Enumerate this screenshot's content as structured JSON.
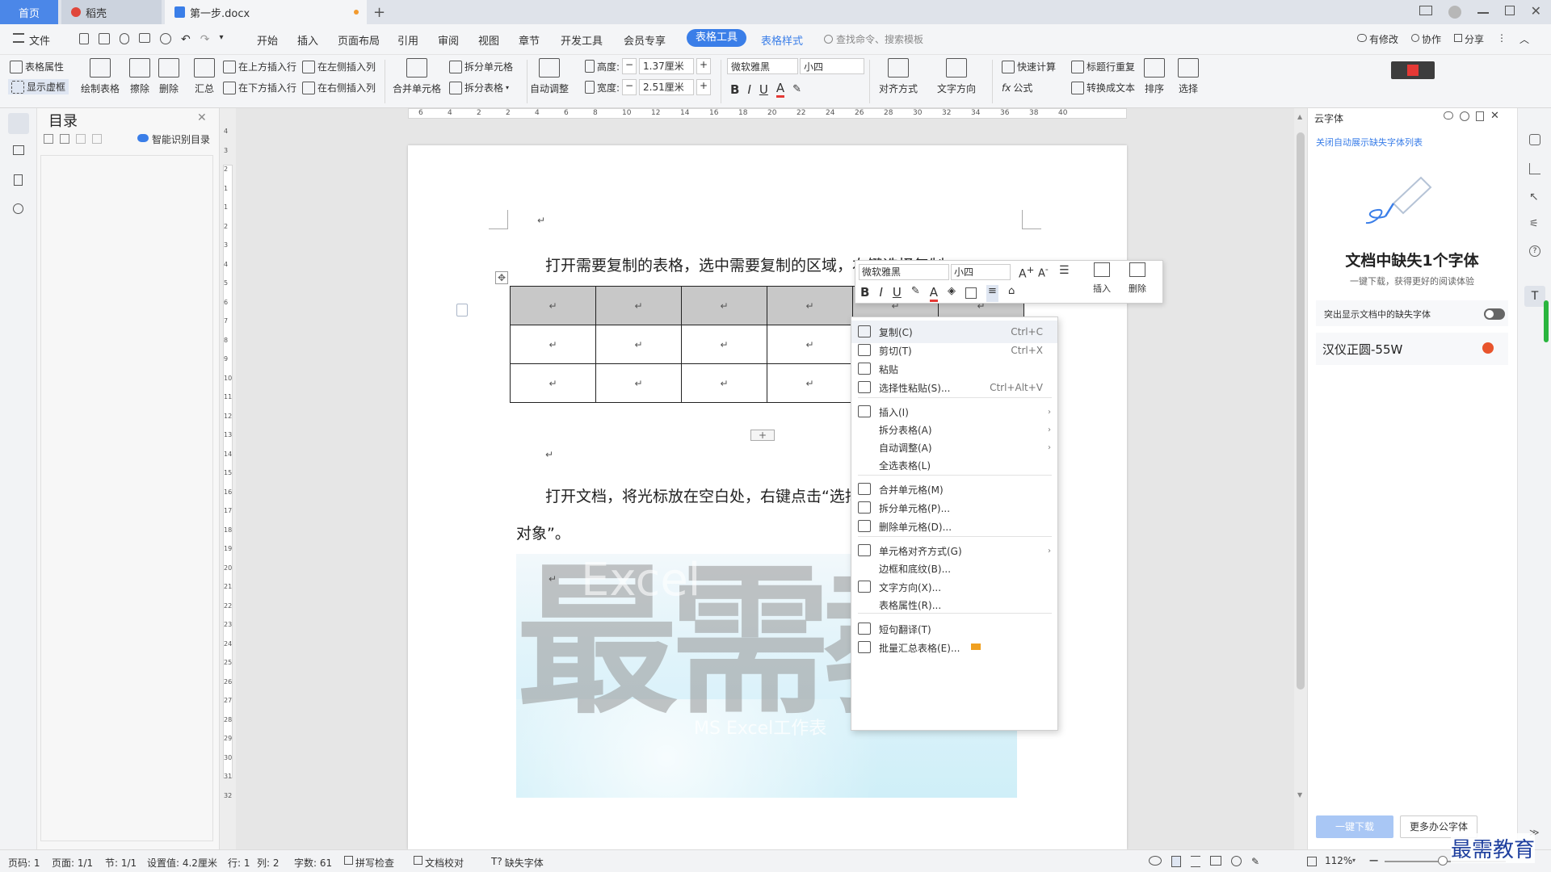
{
  "tabs": {
    "home": "首页",
    "daoke": "稻壳",
    "doc": "第一步.docx",
    "add": "+"
  },
  "menu": {
    "file": "文件",
    "items": [
      "开始",
      "插入",
      "页面布局",
      "引用",
      "审阅",
      "视图",
      "章节",
      "开发工具",
      "会员专享"
    ],
    "active": "表格工具",
    "style": "表格样式",
    "search": "查找命令、搜索模板",
    "right": [
      "有修改",
      "协作",
      "分享"
    ]
  },
  "ribbon": {
    "table_props": "表格属性",
    "show_lines": "显示虚框",
    "draw_table": "绘制表格",
    "erase": "擦除",
    "delete": "删除",
    "sum": "汇总",
    "ins_above": "在上方插入行",
    "ins_below": "在下方插入行",
    "ins_left": "在左侧插入列",
    "ins_right": "在右侧插入列",
    "merge": "合并单元格",
    "split_cell": "拆分单元格",
    "split_table": "拆分表格",
    "auto_fit": "自动调整",
    "height_label": "高度:",
    "height_val": "1.37厘米",
    "width_label": "宽度:",
    "width_val": "2.51厘米",
    "font": "微软雅黑",
    "size": "小四",
    "align": "对齐方式",
    "text_dir": "文字方向",
    "quick_calc": "快速计算",
    "repeat_header": "标题行重复",
    "formula": "公式",
    "to_text": "转换成文本",
    "sort": "排序",
    "select": "选择"
  },
  "toc": {
    "title": "目录",
    "smart": "智能识别目录"
  },
  "ruler": {
    "h": [
      "6",
      "4",
      "2",
      "2",
      "4",
      "6",
      "8",
      "10",
      "12",
      "14",
      "16",
      "18",
      "20",
      "22",
      "24",
      "26",
      "28",
      "30",
      "32",
      "34",
      "36",
      "38",
      "40"
    ],
    "v": [
      "4",
      "3",
      "2",
      "1",
      "1",
      "2",
      "3",
      "4",
      "5",
      "6",
      "7",
      "8",
      "9",
      "10",
      "11",
      "12",
      "13",
      "14",
      "15",
      "16",
      "17",
      "18",
      "19",
      "20",
      "21",
      "22",
      "23",
      "24",
      "25",
      "26",
      "27",
      "28",
      "29",
      "30",
      "31",
      "32"
    ]
  },
  "doc": {
    "p1": "打开需要复制的表格，选中需要复制的区域，右键选择复制。",
    "p2a": "打开文档，将光标放在空白处，右键点击“选择",
    "p2b": "对象”。",
    "ret": "↵",
    "watermark": "最需教",
    "wm_sub": "Excel",
    "wm_sub2": "MS Excel工作表"
  },
  "mini": {
    "font": "微软雅黑",
    "size": "小四",
    "insert": "插入",
    "delete": "删除",
    "bold": "B",
    "italic": "I",
    "underline": "U",
    "fontcolor": "A"
  },
  "context_menu": [
    {
      "label": "复制(C)",
      "shortcut": "Ctrl+C",
      "icon": "copy-icon"
    },
    {
      "label": "剪切(T)",
      "shortcut": "Ctrl+X",
      "icon": "scissors-icon"
    },
    {
      "label": "粘贴",
      "shortcut": "",
      "icon": "paste-icon"
    },
    {
      "label": "选择性粘贴(S)...",
      "shortcut": "Ctrl+Alt+V",
      "icon": "paste-special-icon"
    },
    {
      "label": "插入(I)",
      "sub": true,
      "icon": "table-insert-icon"
    },
    {
      "label": "拆分表格(A)",
      "sub": true
    },
    {
      "label": "自动调整(A)",
      "sub": true
    },
    {
      "label": "全选表格(L)"
    },
    {
      "label": "合并单元格(M)",
      "icon": "merge-cells-icon"
    },
    {
      "label": "拆分单元格(P)...",
      "icon": "split-cells-icon"
    },
    {
      "label": "删除单元格(D)...",
      "icon": "delete-cells-icon"
    },
    {
      "label": "单元格对齐方式(G)",
      "sub": true,
      "icon": "cell-align-icon"
    },
    {
      "label": "边框和底纹(B)..."
    },
    {
      "label": "文字方向(X)...",
      "icon": "text-direction-icon"
    },
    {
      "label": "表格属性(R)..."
    },
    {
      "label": "短句翻译(T)",
      "icon": "translate-icon"
    },
    {
      "label": "批量汇总表格(E)...",
      "icon": "batch-summary-icon"
    }
  ],
  "right_panel": {
    "header": "云字体",
    "link": "关闭自动展示缺失字体列表",
    "title": "文档中缺失1个字体",
    "subtitle": "一键下载，获得更好的阅读体验",
    "toggle_label": "突出显示文档中的缺失字体",
    "font_name": "汉仪正圆-55W",
    "btn_download": "一键下载",
    "btn_more": "更多办公字体"
  },
  "status": {
    "page_code": "页码: 1",
    "page": "页面: 1/1",
    "section": "节: 1/1",
    "setting": "设置值: 4.2厘米",
    "row": "行: 1",
    "col": "列: 2",
    "words": "字数: 61",
    "spell": "拼写检查",
    "proof": "文档校对",
    "missing": "缺失字体",
    "zoom": "112%"
  },
  "brand": "最需教育",
  "colors": {
    "accent": "#3a7ee8",
    "tab_active": "#4b87e8"
  }
}
